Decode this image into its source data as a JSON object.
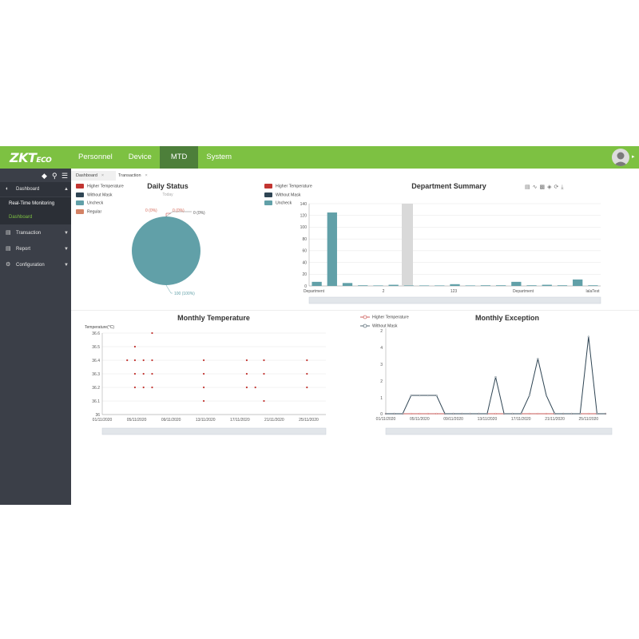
{
  "colors": {
    "brand": "#7dc142",
    "nav_active": "#4d7f3a",
    "sidebar": "#3b3f48",
    "red": "#c23531",
    "navy": "#2f4554",
    "teal": "#61a0a8",
    "salmon": "#d48265"
  },
  "logo": {
    "main": "ZKT",
    "suffix": "ECO"
  },
  "nav": [
    {
      "label": "Personnel"
    },
    {
      "label": "Device"
    },
    {
      "label": "MTD"
    },
    {
      "label": "System"
    }
  ],
  "sidebar": {
    "tools": [
      "tag-icon",
      "search-icon",
      "menu-icon"
    ],
    "items": [
      {
        "label": "Dashboard",
        "icon": "dashboard-icon"
      },
      {
        "label": "Real-Time Monitoring"
      },
      {
        "label": "Dashboard"
      },
      {
        "label": "Transaction",
        "icon": "document-icon"
      },
      {
        "label": "Report",
        "icon": "document-icon"
      },
      {
        "label": "Configuration",
        "icon": "gears-icon"
      }
    ]
  },
  "tabs": [
    {
      "label": "Dashboard"
    },
    {
      "label": "Transaction"
    }
  ],
  "daily_status": {
    "title": "Daily Status",
    "subtitle": "Today",
    "legend": [
      "Higher Temperature",
      "Without Mask",
      "Uncheck",
      "Regular"
    ],
    "labels": {
      "l1": "0 (0%)",
      "l2": "0 (0%)",
      "l3": "0 (0%)",
      "main": "100 (100%)"
    }
  },
  "department_summary": {
    "title": "Department Summary",
    "legend": [
      "Higher Temperature",
      "Without Mask",
      "Uncheck"
    ]
  },
  "monthly_temperature": {
    "title": "Monthly Temperature"
  },
  "monthly_exception": {
    "title": "Monthly Exception",
    "legend": [
      "Higher Temperature",
      "Without Mask"
    ]
  },
  "chart_data": [
    {
      "type": "pie",
      "title": "Daily Status",
      "subtitle": "Today",
      "labels": [
        "Higher Temperature",
        "Without Mask",
        "Uncheck",
        "Regular"
      ],
      "values": [
        0,
        0,
        100,
        0
      ]
    },
    {
      "type": "bar",
      "title": "Department Summary",
      "ylim": [
        0,
        140
      ],
      "yticks": [
        0,
        20,
        40,
        60,
        80,
        100,
        120,
        140
      ],
      "xticklabels": [
        "Department",
        "2",
        "123",
        "Department",
        "lalaTest"
      ],
      "series": [
        {
          "name": "Uncheck",
          "values": [
            7,
            125,
            5,
            1,
            0,
            2,
            0,
            0,
            0,
            3,
            0,
            1,
            1,
            7,
            1,
            2,
            1,
            11,
            1
          ]
        }
      ]
    },
    {
      "type": "scatter",
      "title": "Monthly Temperature",
      "ylabel": "Temperature(°C)",
      "ylim": [
        36,
        36.6
      ],
      "yticks": [
        36,
        36.1,
        36.2,
        36.3,
        36.4,
        36.5,
        36.6
      ],
      "xticklabels": [
        "01/11/2020",
        "05/11/2020",
        "09/11/2020",
        "13/11/2020",
        "17/11/2020",
        "21/11/2020",
        "25/11/2020"
      ],
      "points": [
        {
          "x": 3.9,
          "y": 36.4
        },
        {
          "x": 4.8,
          "y": 36.5
        },
        {
          "x": 4.8,
          "y": 36.4
        },
        {
          "x": 4.8,
          "y": 36.3
        },
        {
          "x": 4.8,
          "y": 36.2
        },
        {
          "x": 5.8,
          "y": 36.4
        },
        {
          "x": 5.8,
          "y": 36.3
        },
        {
          "x": 5.8,
          "y": 36.2
        },
        {
          "x": 6.8,
          "y": 36.6
        },
        {
          "x": 6.8,
          "y": 36.4
        },
        {
          "x": 6.8,
          "y": 36.3
        },
        {
          "x": 6.8,
          "y": 36.2
        },
        {
          "x": 12.8,
          "y": 36.4
        },
        {
          "x": 12.8,
          "y": 36.3
        },
        {
          "x": 12.8,
          "y": 36.2
        },
        {
          "x": 12.8,
          "y": 36.1
        },
        {
          "x": 17.8,
          "y": 36.4
        },
        {
          "x": 17.8,
          "y": 36.3
        },
        {
          "x": 17.8,
          "y": 36.2
        },
        {
          "x": 18.8,
          "y": 36.2
        },
        {
          "x": 19.8,
          "y": 36.4
        },
        {
          "x": 19.8,
          "y": 36.3
        },
        {
          "x": 19.8,
          "y": 36.1
        },
        {
          "x": 24.8,
          "y": 36.4
        },
        {
          "x": 24.8,
          "y": 36.3
        },
        {
          "x": 24.8,
          "y": 36.2
        }
      ]
    },
    {
      "type": "line",
      "title": "Monthly Exception",
      "ylim": [
        0,
        2.2
      ],
      "yticks": [
        0,
        1,
        2,
        3,
        4,
        2
      ],
      "xticklabels": [
        "01/11/2020",
        "05/11/2020",
        "09/11/2020",
        "13/11/2020",
        "17/11/2020",
        "21/11/2020",
        "25/11/2020"
      ],
      "series": [
        {
          "name": "Higher Temperature",
          "values": [
            0,
            0,
            0,
            0,
            0,
            0,
            0,
            0,
            0,
            0,
            0,
            0,
            0,
            0,
            0,
            0,
            0,
            0,
            0,
            0,
            0,
            0,
            0,
            0,
            0,
            0,
            0
          ]
        },
        {
          "name": "Without Mask",
          "values": [
            0,
            0,
            0,
            0.5,
            0.5,
            0.5,
            0.5,
            0,
            0,
            0,
            0,
            0,
            0,
            1,
            0,
            0,
            0,
            0.5,
            1.5,
            0.5,
            0,
            0,
            0,
            0,
            2.1,
            0,
            0
          ]
        }
      ]
    }
  ]
}
